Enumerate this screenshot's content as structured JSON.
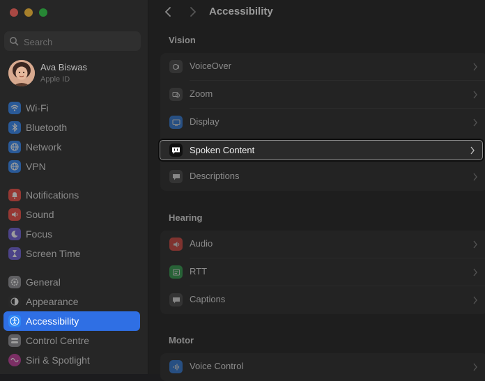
{
  "window": {
    "traffic_lights": [
      {
        "name": "close",
        "color": "#ff5f57"
      },
      {
        "name": "minimize",
        "color": "#febc2e"
      },
      {
        "name": "zoom",
        "color": "#28c840"
      }
    ]
  },
  "search": {
    "placeholder": "Search"
  },
  "profile": {
    "name": "Ava Biswas",
    "subtitle": "Apple ID"
  },
  "sidebar": {
    "items": [
      {
        "label": "Wi-Fi",
        "icon": "wifi-icon",
        "color": "#2e86f5"
      },
      {
        "label": "Bluetooth",
        "icon": "bluetooth-icon",
        "color": "#2e86f5"
      },
      {
        "label": "Network",
        "icon": "globe-icon",
        "color": "#2e86f5"
      },
      {
        "label": "VPN",
        "icon": "vpn-globe-icon",
        "color": "#2e86f5"
      },
      {
        "label": "Notifications",
        "icon": "bell-icon",
        "color": "#f0473e"
      },
      {
        "label": "Sound",
        "icon": "speaker-icon",
        "color": "#f0473e"
      },
      {
        "label": "Focus",
        "icon": "moon-icon",
        "color": "#6b5bd8"
      },
      {
        "label": "Screen Time",
        "icon": "hourglass-icon",
        "color": "#6b5bd8"
      },
      {
        "label": "General",
        "icon": "gear-icon",
        "color": "#8e8e93"
      },
      {
        "label": "Appearance",
        "icon": "appearance-icon",
        "color": "#2b2b2b"
      },
      {
        "label": "Accessibility",
        "icon": "accessibility-icon",
        "color": "#2e86f5",
        "active": true
      },
      {
        "label": "Control Centre",
        "icon": "control-centre-icon",
        "color": "#8e8e93"
      },
      {
        "label": "Siri & Spotlight",
        "icon": "siri-icon",
        "color": "#c2379a"
      }
    ]
  },
  "header": {
    "title": "Accessibility"
  },
  "sections": [
    {
      "title": "Vision",
      "rows": [
        {
          "label": "VoiceOver",
          "icon": "voiceover-icon",
          "color": "#4a4a4a"
        },
        {
          "label": "Zoom",
          "icon": "zoom-icon",
          "color": "#4a4a4a"
        },
        {
          "label": "Display",
          "icon": "display-icon",
          "color": "#2e86f5"
        },
        {
          "label": "Spoken Content",
          "icon": "spoken-content-icon",
          "color": "#1a1a1a",
          "selected": true
        },
        {
          "label": "Descriptions",
          "icon": "descriptions-icon",
          "color": "#4a4a4a"
        }
      ]
    },
    {
      "title": "Hearing",
      "rows": [
        {
          "label": "Audio",
          "icon": "audio-icon",
          "color": "#f0473e"
        },
        {
          "label": "RTT",
          "icon": "rtt-icon",
          "color": "#30b050"
        },
        {
          "label": "Captions",
          "icon": "captions-icon",
          "color": "#4a4a4a"
        }
      ]
    },
    {
      "title": "Motor",
      "rows": [
        {
          "label": "Voice Control",
          "icon": "voice-control-icon",
          "color": "#2e86f5"
        }
      ]
    }
  ]
}
